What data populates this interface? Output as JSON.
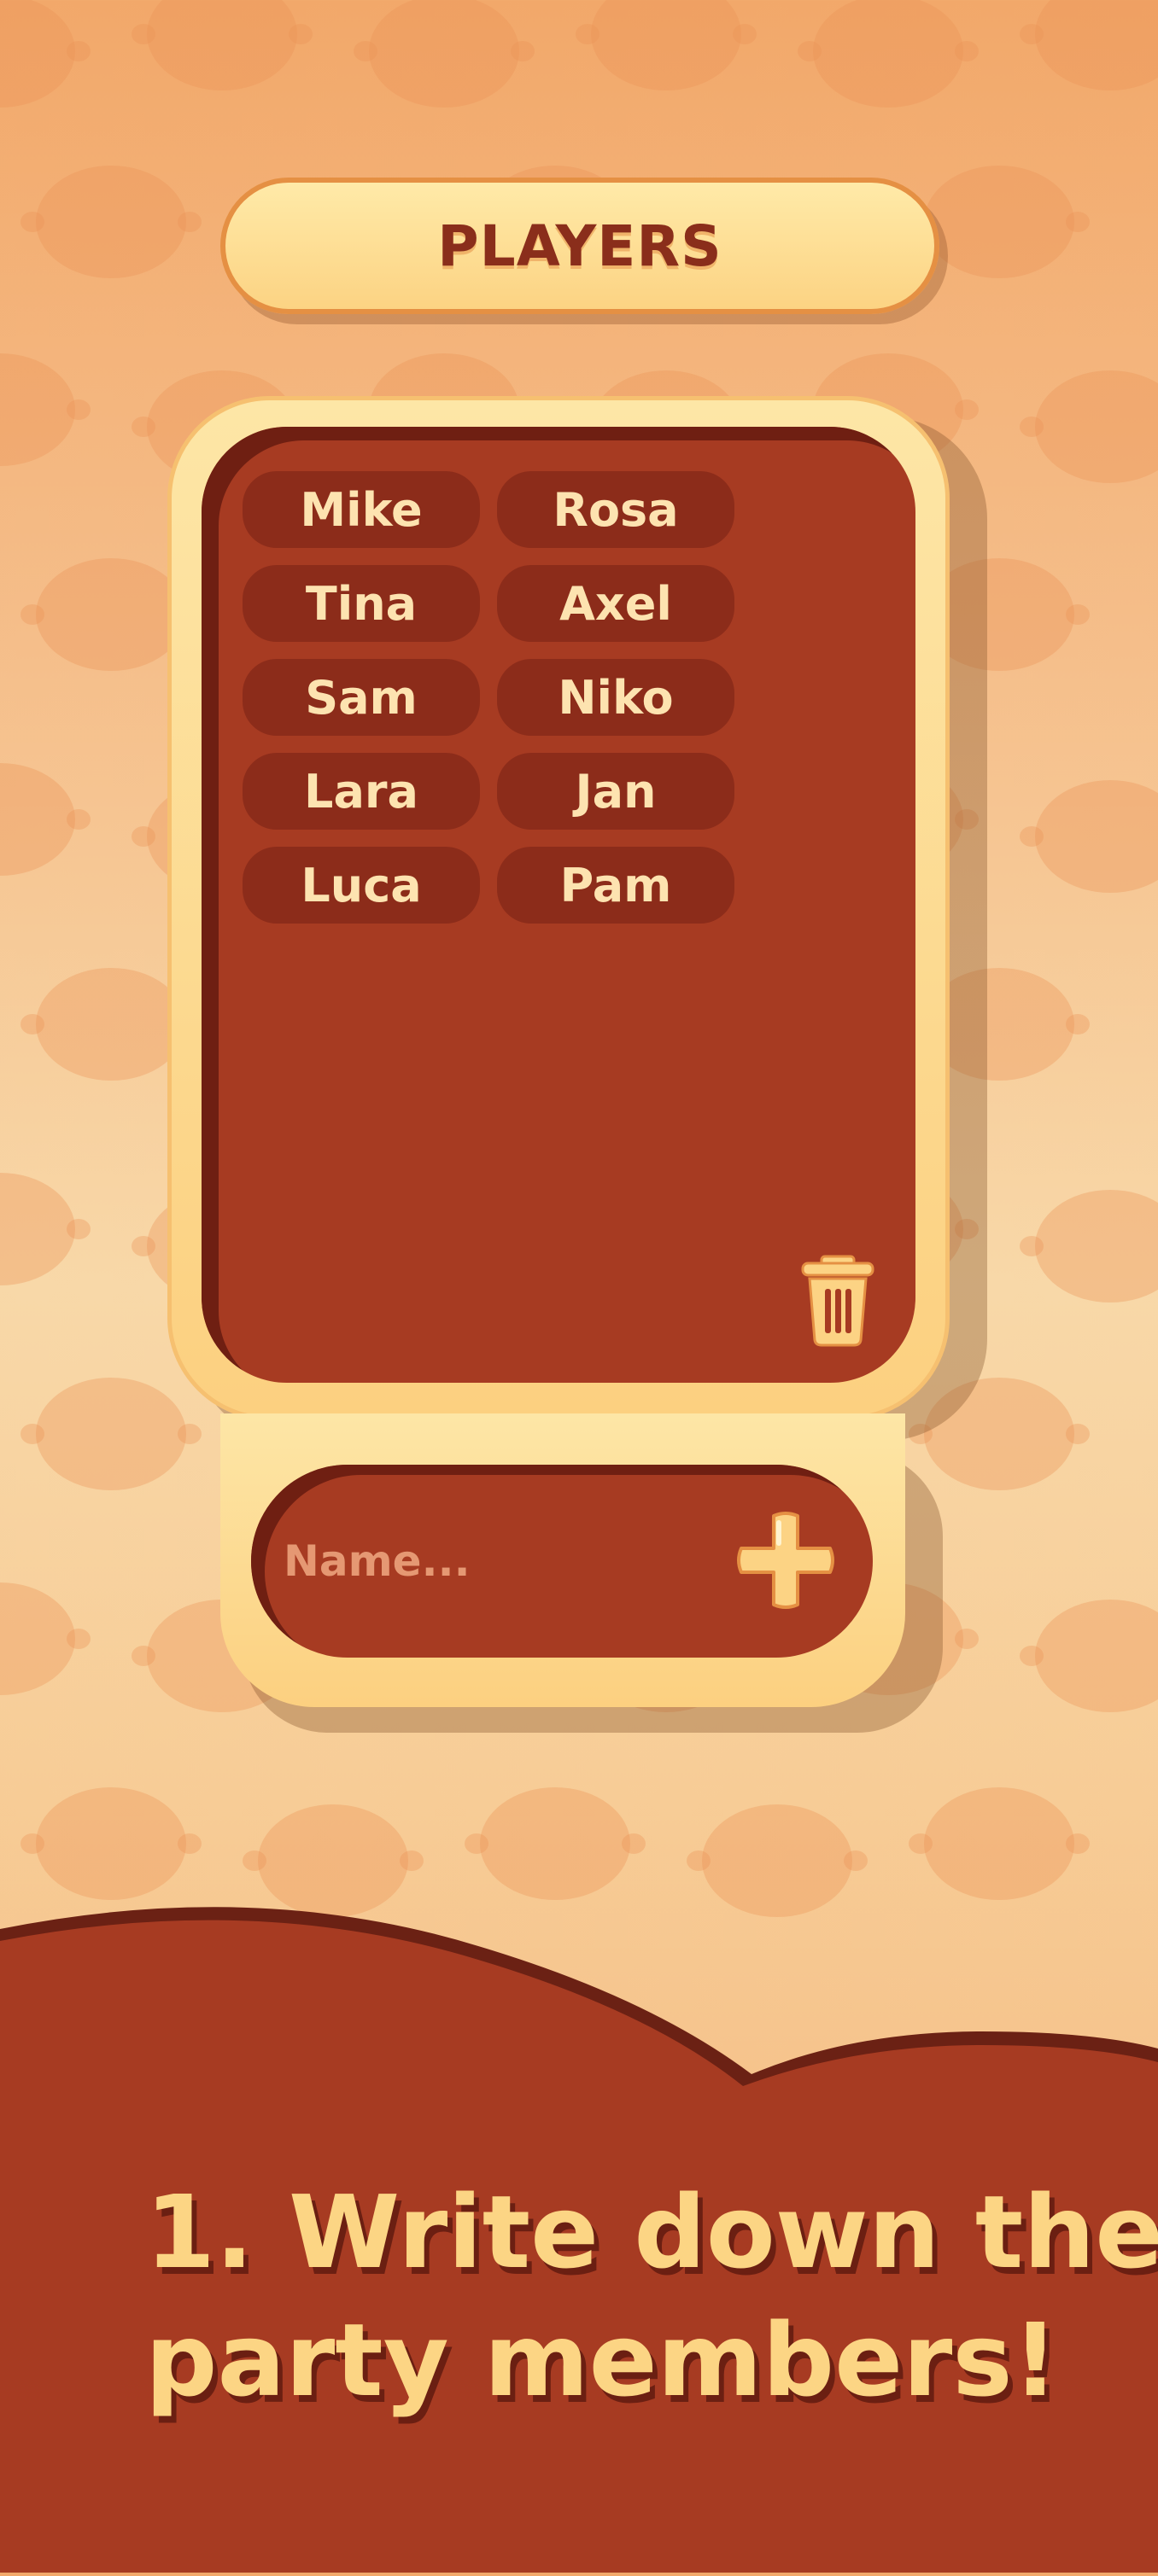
{
  "header": {
    "title": "PLAYERS"
  },
  "players": {
    "names": [
      "Mike",
      "Rosa",
      "Tina",
      "Axel",
      "Sam",
      "Niko",
      "Lara",
      "Jan",
      "Luca",
      "Pam"
    ]
  },
  "input": {
    "placeholder": "Name..."
  },
  "caption": {
    "line1": "1. Write down the",
    "line2": "party members!"
  },
  "colors": {
    "accent": "#a73b22",
    "panel": "#fcd080",
    "chip": "#8c2c1a",
    "text_light": "#fde3b0",
    "title_text": "#8a2e1b"
  },
  "icons": {
    "delete": "trash-icon",
    "add": "plus-icon"
  }
}
